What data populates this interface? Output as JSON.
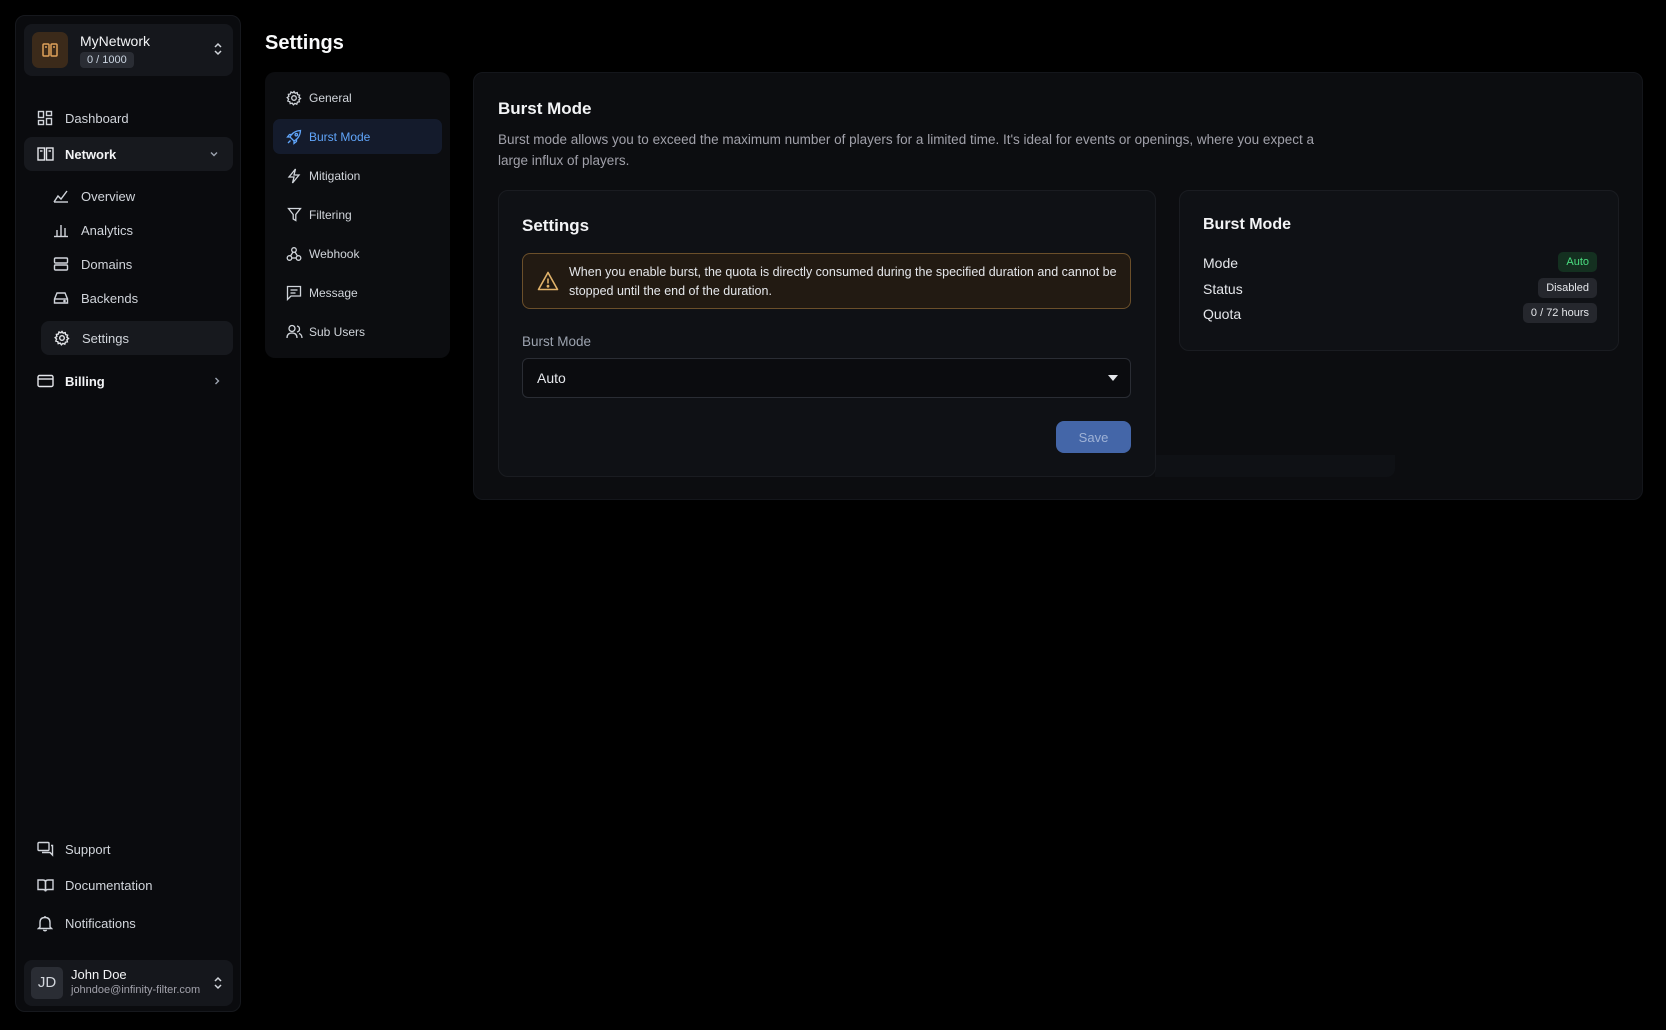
{
  "sidebar": {
    "network": {
      "name": "MyNetwork",
      "count": "0 / 1000"
    },
    "items": [
      {
        "label": "Dashboard"
      },
      {
        "label": "Network"
      },
      {
        "label": "Overview"
      },
      {
        "label": "Analytics"
      },
      {
        "label": "Domains"
      },
      {
        "label": "Backends"
      },
      {
        "label": "Settings"
      },
      {
        "label": "Billing"
      }
    ],
    "footer": [
      {
        "label": "Support"
      },
      {
        "label": "Documentation"
      },
      {
        "label": "Notifications"
      }
    ],
    "user": {
      "initials": "JD",
      "name": "John Doe",
      "email": "johndoe@infinity-filter.com"
    }
  },
  "page": {
    "title": "Settings"
  },
  "settings_menu": [
    {
      "label": "General"
    },
    {
      "label": "Burst Mode"
    },
    {
      "label": "Mitigation"
    },
    {
      "label": "Filtering"
    },
    {
      "label": "Webhook"
    },
    {
      "label": "Message"
    },
    {
      "label": "Sub Users"
    }
  ],
  "burst": {
    "title": "Burst Mode",
    "description": "Burst mode allows you to exceed the maximum number of players for a limited time. It's ideal for events or openings, where you expect a large influx of players.",
    "settings": {
      "title": "Settings",
      "warning": "When you enable burst, the quota is directly consumed during the specified duration and cannot be stopped until the end of the duration.",
      "field_label": "Burst Mode",
      "selected": "Auto",
      "save_label": "Save"
    },
    "status": {
      "title": "Burst Mode",
      "rows": [
        {
          "label": "Mode",
          "value": "Auto"
        },
        {
          "label": "Status",
          "value": "Disabled"
        },
        {
          "label": "Quota",
          "value": "0 / 72 hours"
        }
      ]
    }
  },
  "colors": {
    "accent": "#60a5fa",
    "save_button": "#4466a8",
    "success_badge": "#4ade80",
    "warning_border": "#6b4f2a",
    "warning_icon": "#e0b26a"
  }
}
